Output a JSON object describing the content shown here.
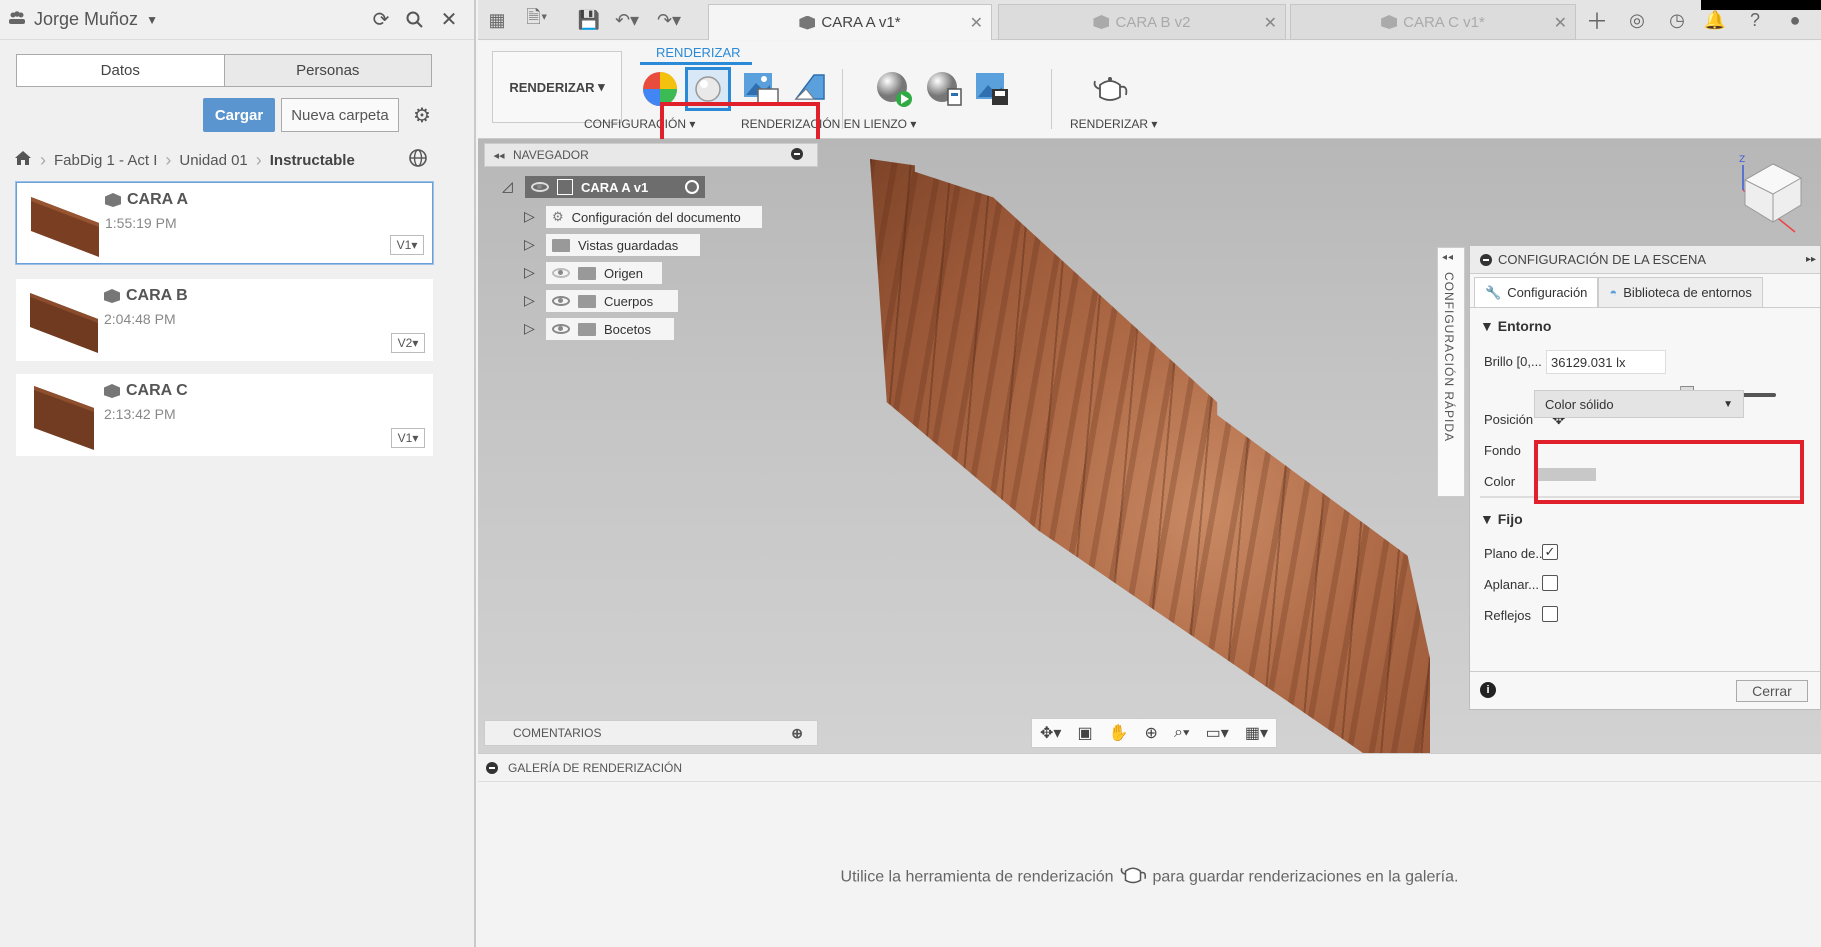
{
  "user": {
    "name": "Jorge Muñoz"
  },
  "data_panel": {
    "tabs": [
      "Datos",
      "Personas"
    ],
    "upload_button": "Cargar",
    "new_folder_button": "Nueva carpeta",
    "breadcrumb": [
      "FabDig 1 - Act I",
      "Unidad 01",
      "Instructable"
    ],
    "files": [
      {
        "name": "CARA A",
        "time": "1:55:19 PM",
        "version": "V1"
      },
      {
        "name": "CARA B",
        "time": "2:04:48 PM",
        "version": "V2"
      },
      {
        "name": "CARA C",
        "time": "2:13:42 PM",
        "version": "V1"
      }
    ]
  },
  "tabs": [
    {
      "label": "CARA A v1*",
      "active": true
    },
    {
      "label": "CARA B v2",
      "active": false
    },
    {
      "label": "CARA C v1*",
      "active": false
    }
  ],
  "toolbar": {
    "workspace": "RENDERIZAR",
    "workspace_tab": "RENDERIZAR",
    "groups": {
      "config": "CONFIGURACIÓN",
      "canvas": "RENDERIZACIÓN EN LIENZO",
      "render": "RENDERIZAR"
    }
  },
  "browser": {
    "title": "NAVEGADOR",
    "root": "CARA A v1",
    "items": [
      "Configuración del documento",
      "Vistas guardadas",
      "Origen",
      "Cuerpos",
      "Bocetos"
    ]
  },
  "comments": {
    "title": "COMENTARIOS"
  },
  "quick_setup": {
    "label": "CONFIGURACIÓN RÁPIDA"
  },
  "scene_settings": {
    "title": "CONFIGURACIÓN DE LA ESCENA",
    "tabs": [
      "Configuración",
      "Biblioteca de entornos"
    ],
    "environment": {
      "section": "Entorno",
      "brightness_label": "Brillo [0,...",
      "brightness_value": "36129.031 lx",
      "brightness_level": 0.6,
      "position_label": "Posición",
      "background_label": "Fondo",
      "background_value": "Color sólido",
      "color_label": "Color",
      "color_value": "#c8c8c8"
    },
    "ground": {
      "section": "Fijo",
      "options": [
        {
          "label": "Plano de...",
          "checked": true
        },
        {
          "label": "Aplanar...",
          "checked": false
        },
        {
          "label": "Reflejos",
          "checked": false
        }
      ]
    },
    "close_button": "Cerrar"
  },
  "gallery": {
    "title": "GALERÍA DE RENDERIZACIÓN",
    "message_before": "Utilice la herramienta de renderización",
    "message_after": "para guardar renderizaciones en la galería."
  },
  "colors": {
    "accent": "#2a8ad8",
    "highlight": "#e0202a",
    "upload": "#5b95cf"
  }
}
